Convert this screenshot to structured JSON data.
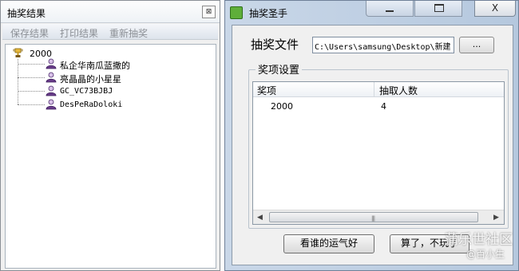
{
  "left_window": {
    "title": "抽奖结果",
    "close_glyph": "⊠",
    "menu": [
      "保存结果",
      "打印结果",
      "重新抽奖"
    ],
    "tree": {
      "root": {
        "label": "2000",
        "icon": "trophy-icon"
      },
      "children": [
        {
          "label": "私企华南瓜蓝撒的",
          "icon": "winner-avatar-icon"
        },
        {
          "label": "亮晶晶的小星星",
          "icon": "winner-avatar-icon"
        },
        {
          "label": "GC_VC73BJBJ",
          "icon": "winner-avatar-icon"
        },
        {
          "label": "DesPeRaDoloki",
          "icon": "winner-avatar-icon"
        }
      ]
    }
  },
  "right_window": {
    "title": "抽奖圣手",
    "close_glyph": "X",
    "file_label": "抽奖文件",
    "file_path": "C:\\Users\\samsung\\Desktop\\新建",
    "browse_label": "...",
    "group_label": "奖项设置",
    "columns": [
      "奖项",
      "抽取人数"
    ],
    "rows": [
      {
        "prize": "2000",
        "count": "4"
      }
    ],
    "buttons": {
      "lucky": "看谁的运气好",
      "quit": "算了，不玩了"
    }
  },
  "watermark": {
    "main": "蒲乐世社区",
    "sub": "@百小生"
  },
  "colors": {
    "title_bar": "#c9d7e8",
    "window_bg": "#f0f0f0",
    "accent_green": "#5fae3a"
  }
}
